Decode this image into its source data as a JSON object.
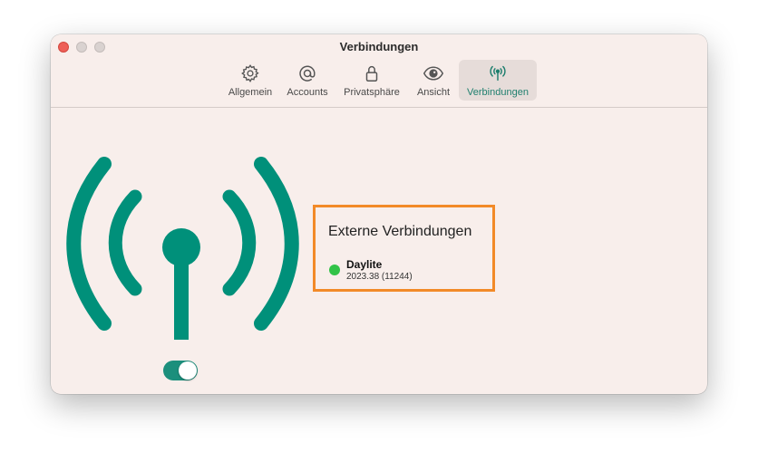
{
  "window": {
    "title": "Verbindungen"
  },
  "toolbar": {
    "tabs": [
      {
        "label": "Allgemein",
        "icon": "gear-icon",
        "active": false
      },
      {
        "label": "Accounts",
        "icon": "at-icon",
        "active": false
      },
      {
        "label": "Privatsphäre",
        "icon": "lock-icon",
        "active": false
      },
      {
        "label": "Ansicht",
        "icon": "eye-icon",
        "active": false
      },
      {
        "label": "Verbindungen",
        "icon": "antenna-icon",
        "active": true
      }
    ]
  },
  "main": {
    "connection_icon": "antenna-icon",
    "toggle": {
      "on": true
    }
  },
  "external": {
    "title": "Externe Verbindungen",
    "service": {
      "name": "Daylite",
      "version": "2023.38 (11244)",
      "status_color": "#32c348"
    }
  },
  "colors": {
    "accent": "#00907a",
    "highlight_border": "#f28a28",
    "window_bg": "#f8eeeb"
  }
}
